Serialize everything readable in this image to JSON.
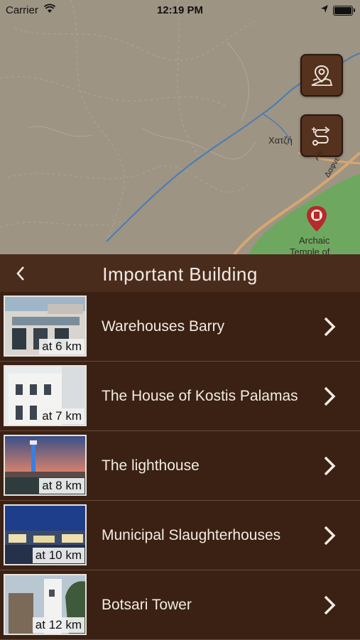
{
  "status_bar": {
    "carrier": "Carrier",
    "time": "12:19 PM"
  },
  "map": {
    "labels": {
      "place_1": "Χατζή",
      "road_1": "Αιγ",
      "road_2": "Δαφνε",
      "poi_line1": "Archaic",
      "poi_line2": "Temple of"
    },
    "buttons": [
      {
        "icon": "map-location-icon"
      },
      {
        "icon": "route-icon"
      }
    ],
    "colors": {
      "button_bg": "#54321e",
      "water": "#4a7bb5",
      "road": "#e0b07a",
      "park": "#6ea860"
    }
  },
  "panel": {
    "title": "Important Building",
    "colors": {
      "background": "#3a2114",
      "header": "#4a2c1d",
      "divider": "#6a4a38"
    },
    "items": [
      {
        "name": "Warehouses Barry",
        "distance": "at 6 km"
      },
      {
        "name": "The House of Kostis Palamas",
        "distance": "at 7 km"
      },
      {
        "name": "The lighthouse",
        "distance": "at 8 km"
      },
      {
        "name": "Municipal Slaughterhouses",
        "distance": "at 10 km"
      },
      {
        "name": "Botsari Tower",
        "distance": "at 12 km"
      }
    ]
  }
}
